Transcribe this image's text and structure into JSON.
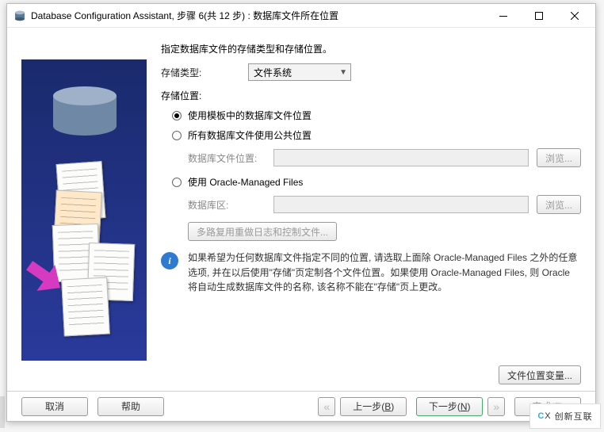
{
  "window": {
    "title": "Database Configuration Assistant, 步骤 6(共 12 步) : 数据库文件所在位置"
  },
  "intro": "指定数据库文件的存储类型和存储位置。",
  "storage_type": {
    "label": "存储类型:",
    "value": "文件系统"
  },
  "storage_loc_title": "存储位置:",
  "options": {
    "template": "使用模板中的数据库文件位置",
    "common": "所有数据库文件使用公共位置",
    "omf": "使用 Oracle-Managed Files"
  },
  "sub": {
    "db_file_loc_label": "数据库文件位置:",
    "db_area_label": "数据库区:",
    "browse": "浏览...",
    "multiplex": "多路复用重做日志和控制文件..."
  },
  "info": "如果希望为任何数据库文件指定不同的位置, 请选取上面除 Oracle-Managed Files 之外的任意选项, 并在以后使用\"存储\"页定制各个文件位置。如果使用 Oracle-Managed Files, 则 Oracle 将自动生成数据库文件的名称, 该名称不能在\"存储\"页上更改。",
  "file_var_btn": "文件位置变量...",
  "buttons": {
    "cancel": "取消",
    "help": "帮助",
    "back_pre": "上一步(",
    "back_key": "B",
    "back_post": ")",
    "next_pre": "下一步(",
    "next_key": "N",
    "next_post": ")",
    "finish_pre": "完成(",
    "finish_key": "F",
    "finish_post": ")"
  },
  "watermark": "创新互联"
}
